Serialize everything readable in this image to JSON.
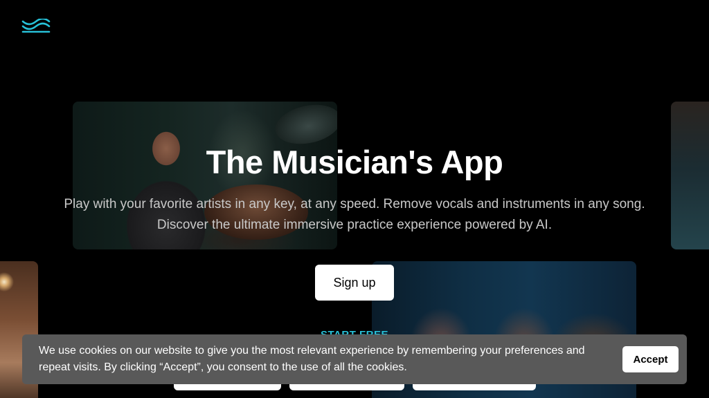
{
  "brand": {
    "logo_icon": "wave-logo-icon",
    "accent_color": "#27c1d8"
  },
  "hero": {
    "title": "The Musician's App",
    "subtitle_line1": "Play with your favorite artists in any key, at any speed. Remove vocals and instruments in any song.",
    "subtitle_line2": "Discover the ultimate immersive practice experience powered by AI.",
    "signup_label": "Sign up",
    "start_free_label": "START FREE"
  },
  "cookie_banner": {
    "text": "We use cookies on our website to give you the most relevant experience by remembering your preferences and repeat visits. By clicking “Accept”, you consent to the use of all the cookies.",
    "accept_label": "Accept"
  }
}
